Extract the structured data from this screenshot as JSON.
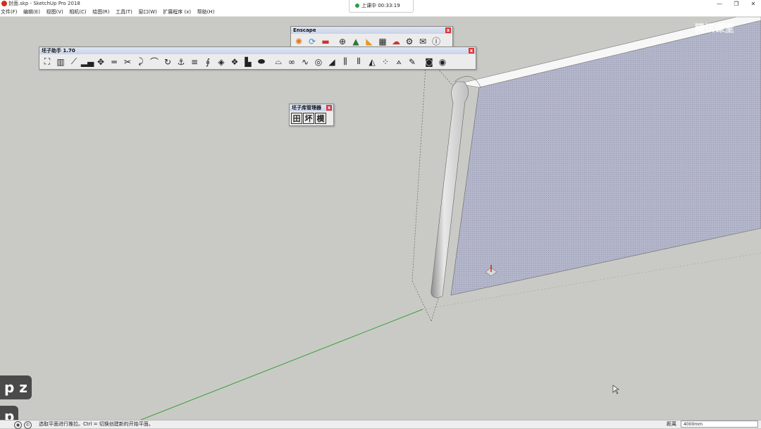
{
  "window": {
    "title": "封面.skp - SketchUp Pro 2018",
    "minimize": "—",
    "restore": "❐",
    "close": "✕"
  },
  "recording": {
    "status": "上课中 00:33:19"
  },
  "menu": {
    "items": [
      "文件(F)",
      "编辑(E)",
      "视图(V)",
      "相机(C)",
      "绘图(R)",
      "工具(T)",
      "窗口(W)",
      "扩展程序 (x)",
      "帮助(H)"
    ]
  },
  "watermark": "腾讯课堂",
  "toolbars": {
    "enscape": {
      "title": "Enscape",
      "icons": [
        "enscape-logo-icon",
        "sync-icon",
        "capture-icon",
        "plus-icon",
        "tree-icon",
        "sun-icon",
        "checker-icon",
        "upload-cloud-icon",
        "gear-icon",
        "mail-icon",
        "info-icon"
      ]
    },
    "assistant": {
      "title": "坯子助手 1.70",
      "icons": [
        "stair-icon",
        "railing-icon",
        "ramp-icon",
        "bars-icon",
        "move-arrows-icon",
        "align-icon",
        "scissors-icon",
        "curve-icon",
        "bridge-icon",
        "rotate-icon",
        "hook-icon",
        "equal-icon",
        "spiral-icon",
        "diamond-icon",
        "cube-icon",
        "stack-icon",
        "pill-icon",
        "arch-icon",
        "chain-icon",
        "wave-icon",
        "target-icon",
        "fan-icon",
        "comb-icon",
        "column-icon",
        "triangle-icon",
        "dots-icon",
        "compass-icon",
        "brush-icon",
        "zoom-icon",
        "shield-icon"
      ]
    },
    "library": {
      "title": "坯子库管理器",
      "buttons": [
        "田",
        "坏",
        "模"
      ]
    }
  },
  "side_badges": [
    "p z",
    "p"
  ],
  "statusbar": {
    "help_text": "选取平面进行推拉。Ctrl = 切换创建新的开始平面。",
    "measure_label": "距离",
    "measure_value": "4000mm"
  },
  "colors": {
    "viewport": "#c9cac5",
    "panel_face": "#b5b7cc",
    "panel_top": "#f7f7f7",
    "axis_green": "#3f9e3f"
  }
}
